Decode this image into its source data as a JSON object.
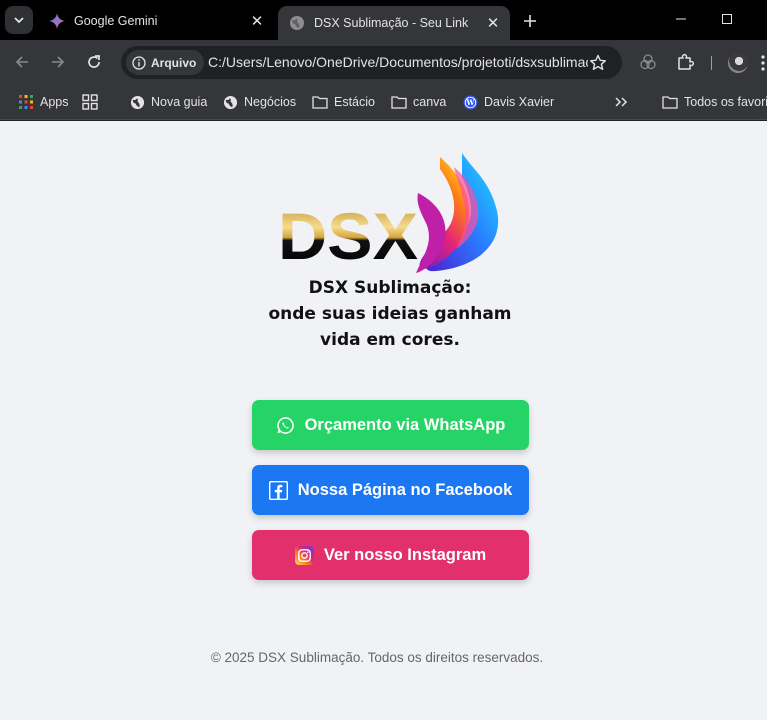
{
  "tabs": [
    {
      "title": "Google Gemini",
      "favicon": "gemini-icon",
      "active": false
    },
    {
      "title": "DSX Sublimação - Seu Link",
      "favicon": "globe-icon",
      "active": true
    }
  ],
  "toolbar": {
    "security_chip": "Arquivo",
    "url": "C:/Users/Lenovo/OneDrive/Documentos/projetoti/dsxsublimacao/index.html"
  },
  "bookmarks": {
    "items": [
      {
        "label": "Apps",
        "icon": "apps-grid-icon"
      },
      {
        "label": "Nova guia",
        "icon": "globe-icon"
      },
      {
        "label": "Negócios",
        "icon": "globe-icon"
      },
      {
        "label": "Estácio",
        "icon": "folder-icon"
      },
      {
        "label": "canva",
        "icon": "folder-icon"
      },
      {
        "label": "Davis Xavier",
        "icon": "wordpress-icon"
      }
    ],
    "all_bookmarks": "Todos os favoritos"
  },
  "page": {
    "logo_text": "DSX",
    "tagline": [
      "DSX Sublimação:",
      "onde suas ideias ganham",
      "vida em cores."
    ],
    "buttons": [
      {
        "label": "Orçamento via WhatsApp",
        "icon": "whatsapp-icon",
        "color": "#25d366"
      },
      {
        "label": "Nossa Página no Facebook",
        "icon": "facebook-icon",
        "color": "#1b77f2"
      },
      {
        "label": "Ver nosso Instagram",
        "icon": "instagram-icon",
        "color": "#e1306c"
      }
    ],
    "footer": "© 2025 DSX Sublimação. Todos os direitos reservados."
  },
  "colors": {
    "page_background": "#f1f2f6",
    "browser_frame": "#35363a"
  }
}
